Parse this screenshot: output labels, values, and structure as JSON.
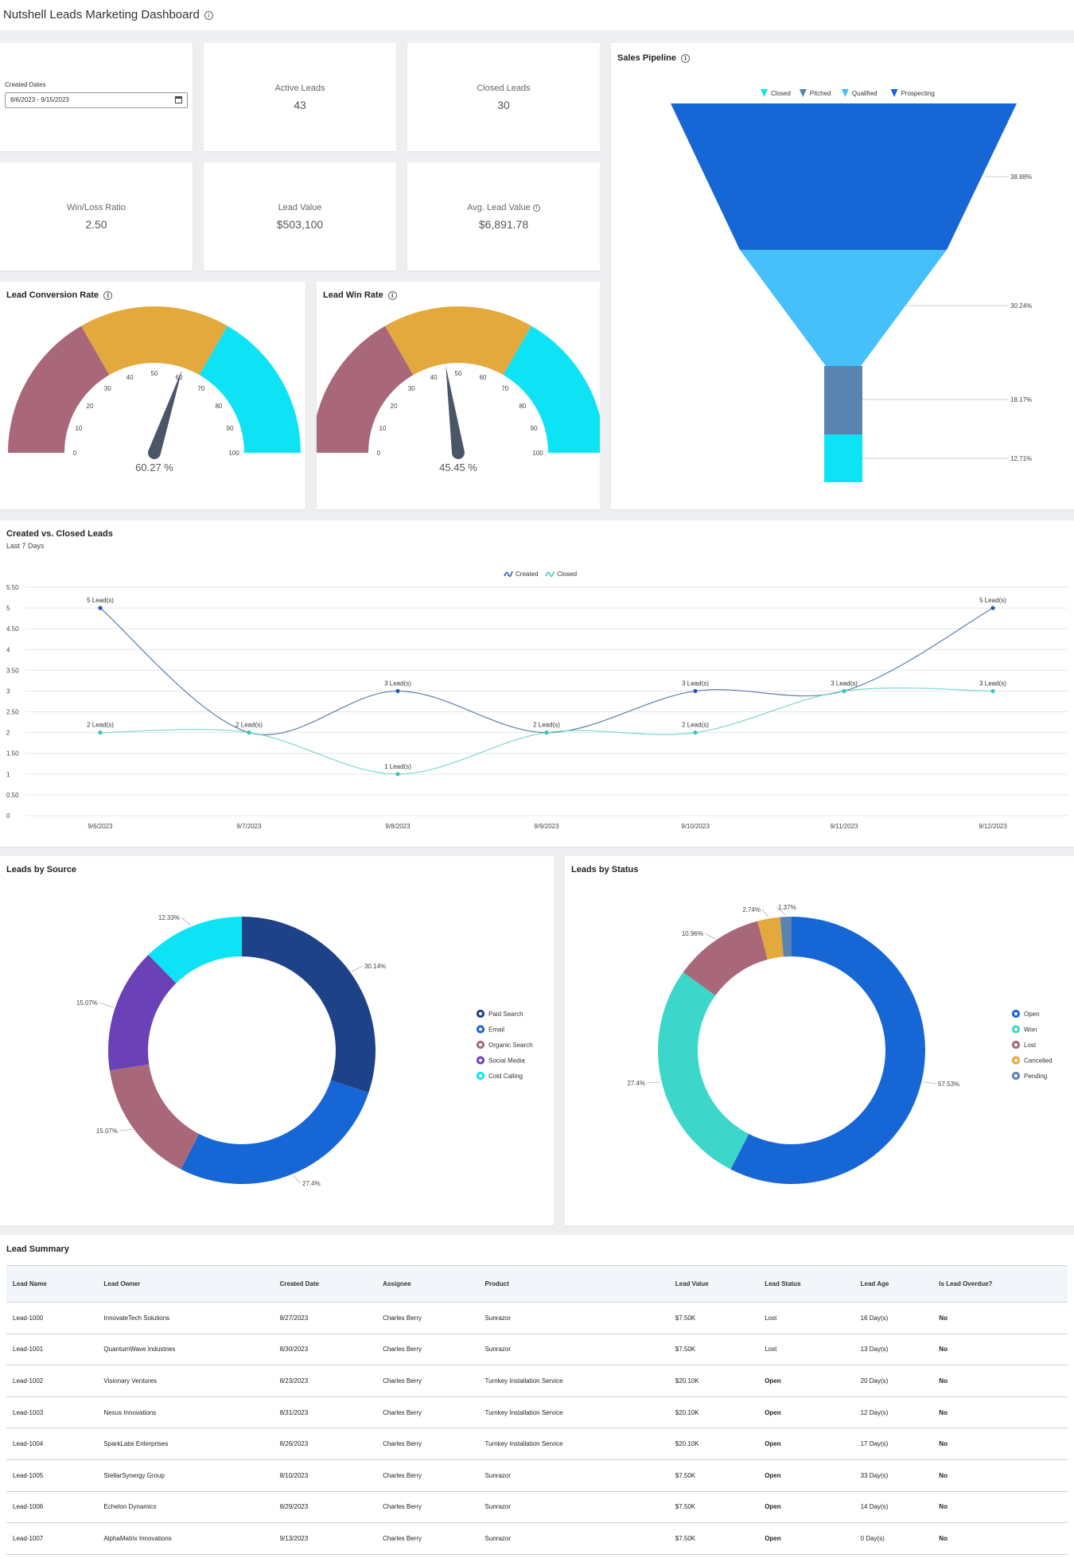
{
  "app": {
    "title": "Nutshell Leads Marketing Dashboard"
  },
  "filters": {
    "created_dates_label": "Created Dates",
    "created_dates_value": "8/6/2023 - 9/15/2023"
  },
  "kpis": [
    {
      "label": "Active Leads",
      "value": "43"
    },
    {
      "label": "Closed Leads",
      "value": "30"
    },
    {
      "label": "Win/Loss Ratio",
      "value": "2.50"
    },
    {
      "label": "Lead Value",
      "value": "$503,100"
    },
    {
      "label": "Avg. Lead Value",
      "value": "$6,891.78"
    }
  ],
  "gauges": {
    "conversion": {
      "title": "Lead Conversion Rate",
      "value": 60.27,
      "value_label": "60.27 %"
    },
    "win": {
      "title": "Lead Win Rate",
      "value": 45.45,
      "value_label": "45.45 %"
    },
    "ticks": [
      "0",
      "10",
      "20",
      "30",
      "40",
      "50",
      "60",
      "70",
      "80",
      "90",
      "100"
    ],
    "band_colors": [
      "#a8687a",
      "#e4a93d",
      "#0de3f5"
    ],
    "needle_color": "#4a5568"
  },
  "pipeline": {
    "title": "Sales Pipeline",
    "legend": [
      "Closed",
      "Pitched",
      "Qualified",
      "Prospecting"
    ],
    "stages": [
      {
        "name": "Prospecting",
        "pct": "38.88%",
        "color": "#1766d6"
      },
      {
        "name": "Qualified",
        "pct": "30.24%",
        "color": "#45c0fb"
      },
      {
        "name": "Pitched",
        "pct": "18.17%",
        "color": "#5a84b0"
      },
      {
        "name": "Closed",
        "pct": "12.71%",
        "color": "#0de3f5"
      }
    ]
  },
  "line_chart": {
    "title": "Created vs. Closed Leads",
    "subtitle": "Last 7 Days"
  },
  "chart_data": [
    {
      "type": "line",
      "title": "Created vs. Closed Leads",
      "subtitle": "Last 7 Days",
      "categories": [
        "9/6/2023",
        "9/7/2023",
        "9/8/2023",
        "9/9/2023",
        "9/10/2023",
        "9/11/2023",
        "9/12/2023"
      ],
      "series": [
        {
          "name": "Created",
          "values": [
            5,
            2,
            3,
            2,
            3,
            3,
            5
          ],
          "labels": [
            "5 Lead(s)",
            "2 Lead(s)",
            "3 Lead(s)",
            "2 Lead(s)",
            "3 Lead(s)",
            "3 Lead(s)",
            "5 Lead(s)"
          ],
          "color": "#5b7fa6",
          "point_color": "#2457b8"
        },
        {
          "name": "Closed",
          "values": [
            2,
            2,
            1,
            2,
            2,
            3,
            3
          ],
          "labels": [
            "2 Lead(s)",
            "",
            "1 Lead(s)",
            "",
            "2 Lead(s)",
            "",
            "3 Lead(s)"
          ],
          "color": "#7dd8d0",
          "point_color": "#3cc6bb"
        }
      ],
      "yticks": [
        "0",
        "0.50",
        "1",
        "1.50",
        "2",
        "2.50",
        "3",
        "3.50",
        "4",
        "4.50",
        "5",
        "5.50"
      ],
      "ylim": [
        0,
        5.5
      ],
      "grid": true,
      "legend": "top-center"
    },
    {
      "type": "pie",
      "title": "Leads by Source",
      "slices": [
        {
          "name": "Paid Search",
          "value": 30.14,
          "label": "30.14%",
          "color": "#1e4287"
        },
        {
          "name": "Email",
          "value": 27.4,
          "label": "27.4%",
          "color": "#1766d6"
        },
        {
          "name": "Organic Search",
          "value": 15.07,
          "label": "15.07%",
          "color": "#a8687a"
        },
        {
          "name": "Social Media",
          "value": 15.07,
          "label": "15.07%",
          "color": "#6b41b8"
        },
        {
          "name": "Cold Calling",
          "value": 12.33,
          "label": "12.33%",
          "color": "#0de3f5"
        }
      ],
      "legend": "right"
    },
    {
      "type": "pie",
      "title": "Leads by Status",
      "slices": [
        {
          "name": "Open",
          "value": 57.53,
          "label": "57.53%",
          "color": "#1766d6"
        },
        {
          "name": "Won",
          "value": 27.4,
          "label": "27.4%",
          "color": "#3dd6ca"
        },
        {
          "name": "Lost",
          "value": 10.96,
          "label": "10.96%",
          "color": "#a8687a"
        },
        {
          "name": "Cancelled",
          "value": 2.74,
          "label": "2.74%",
          "color": "#e4a93d"
        },
        {
          "name": "Pending",
          "value": 1.37,
          "label": "1.37%",
          "color": "#5a84b0"
        }
      ],
      "legend": "right"
    }
  ],
  "summary": {
    "title": "Lead Summary",
    "columns": [
      "Lead Name",
      "Lead Owner",
      "Created Date",
      "Assignee",
      "Product",
      "Lead Value",
      "Lead Status",
      "Lead Age",
      "Is Lead Overdue?"
    ],
    "rows": [
      [
        "Lead-1000",
        "InnovateTech Solutions",
        "8/27/2023",
        "Charles Berry",
        "Sunrazor",
        "$7.50K",
        "Lost",
        "16 Day(s)",
        "No"
      ],
      [
        "Lead-1001",
        "QuantumWave Industries",
        "8/30/2023",
        "Charles Berry",
        "Sunrazor",
        "$7.50K",
        "Lost",
        "13 Day(s)",
        "No"
      ],
      [
        "Lead-1002",
        "Visionary Ventures",
        "8/23/2023",
        "Charles Berry",
        "Turnkey Installation Service",
        "$20.10K",
        "Open",
        "20 Day(s)",
        "No"
      ],
      [
        "Lead-1003",
        "Nexus Innovations",
        "8/31/2023",
        "Charles Berry",
        "Turnkey Installation Service",
        "$20.10K",
        "Open",
        "12 Day(s)",
        "No"
      ],
      [
        "Lead-1004",
        "SparkLabs Enterprises",
        "8/26/2023",
        "Charles Berry",
        "Turnkey Installation Service",
        "$20.10K",
        "Open",
        "17 Day(s)",
        "No"
      ],
      [
        "Lead-1005",
        "StellarSynergy Group",
        "8/10/2023",
        "Charles Berry",
        "Sunrazor",
        "$7.50K",
        "Open",
        "33 Day(s)",
        "No"
      ],
      [
        "Lead-1006",
        "Echelon Dynamics",
        "8/29/2023",
        "Charles Berry",
        "Sunrazor",
        "$7.50K",
        "Open",
        "14 Day(s)",
        "No"
      ],
      [
        "Lead-1007",
        "AlphaMatrix Innovations",
        "9/13/2023",
        "Charles Berry",
        "Sunrazor",
        "$7.50K",
        "Open",
        "0 Day(s)",
        "No"
      ]
    ]
  }
}
